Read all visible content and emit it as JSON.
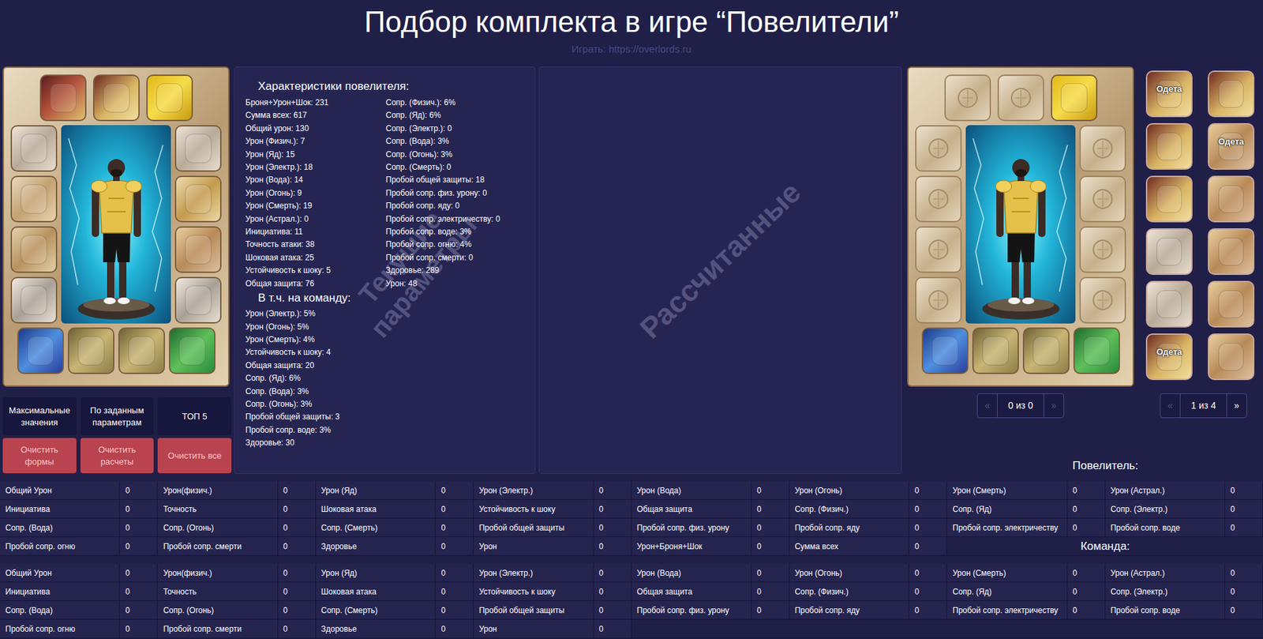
{
  "header": {
    "title": "Подбор комплекта в игре “Повелители”",
    "subtitle": "Играть: https://overlords.ru"
  },
  "current_doll": {
    "top": [
      {
        "kind": "emblem",
        "filled": true
      },
      {
        "kind": "helmet",
        "filled": true
      },
      {
        "kind": "amulet",
        "filled": true
      }
    ],
    "left": [
      {
        "kind": "weapon",
        "filled": true
      },
      {
        "kind": "pants",
        "filled": true
      },
      {
        "kind": "boots",
        "filled": true
      },
      {
        "kind": "ring",
        "filled": true
      }
    ],
    "right": [
      {
        "kind": "weapon",
        "filled": true
      },
      {
        "kind": "armor",
        "filled": true
      },
      {
        "kind": "gloves",
        "filled": true
      },
      {
        "kind": "ring",
        "filled": true
      }
    ],
    "bottom": [
      {
        "kind": "scroll",
        "filled": true
      },
      {
        "kind": "bag",
        "filled": true
      },
      {
        "kind": "bag",
        "filled": true
      },
      {
        "kind": "banner",
        "filled": true
      }
    ]
  },
  "calculated_doll": {
    "top": [
      {
        "kind": "emblem",
        "filled": false
      },
      {
        "kind": "helmet",
        "filled": false
      },
      {
        "kind": "amulet",
        "filled": true
      }
    ],
    "left": [
      {
        "kind": "weapon",
        "filled": false
      },
      {
        "kind": "pants",
        "filled": false
      },
      {
        "kind": "boots",
        "filled": false
      },
      {
        "kind": "ring",
        "filled": false
      }
    ],
    "right": [
      {
        "kind": "weapon",
        "filled": false
      },
      {
        "kind": "armor",
        "filled": false
      },
      {
        "kind": "gloves",
        "filled": false
      },
      {
        "kind": "ring",
        "filled": false
      }
    ],
    "bottom": [
      {
        "kind": "scroll",
        "filled": true
      },
      {
        "kind": "bag",
        "filled": true
      },
      {
        "kind": "bag",
        "filled": true
      },
      {
        "kind": "banner",
        "filled": true
      }
    ]
  },
  "actions": [
    {
      "label": "Максимальные значения",
      "kind": "primary"
    },
    {
      "label": "По заданным параметрам",
      "kind": "primary"
    },
    {
      "label": "ТОП 5",
      "kind": "primary"
    },
    {
      "label": "Очистить формы",
      "kind": "danger"
    },
    {
      "label": "Очистить расчеты",
      "kind": "danger"
    },
    {
      "label": "Очистить все",
      "kind": "danger"
    }
  ],
  "stats": {
    "title": "Характеристики повелителя:",
    "left": [
      "Броня+Урон+Шок: 231",
      "Сумма всех: 617",
      "Общий урон: 130",
      "Урон (Физич.): 7",
      "Урон (Яд): 15",
      "Урон (Электр.): 18",
      "Урон (Вода): 14",
      "Урон (Огонь): 9",
      "Урон (Смерть): 19",
      "Урон (Астрал.): 0",
      "Инициатива: 11",
      "Точность атаки: 38",
      "Шоковая атака: 25",
      "Устойчивость к шоку: 5",
      "Общая защита: 76"
    ],
    "right": [
      "Сопр. (Физич.): 6%",
      "Сопр. (Яд): 6%",
      "Сопр. (Электр.): 0",
      "Сопр. (Вода): 3%",
      "Сопр. (Огонь): 3%",
      "Сопр. (Смерть): 0",
      "Пробой общей защиты: 18",
      "Пробой сопр. физ. урону: 0",
      "Пробой сопр. яду: 0",
      "Пробой сопр. электричеству: 0",
      "Пробой сопр. воде: 3%",
      "Пробой сопр. огню: 4%",
      "Пробой сопр. смерти: 0",
      "Здоровье: 289",
      "Урон: 48"
    ],
    "team_title": "В т.ч. на команду:",
    "team": [
      "Урон (Электр.): 5%",
      "Урон (Огонь): 5%",
      "Урон (Смерть): 4%",
      "Устойчивость к шоку: 4",
      "Общая защита: 20",
      "Сопр. (Яд): 6%",
      "Сопр. (Вода): 3%",
      "Сопр. (Огонь): 3%",
      "Пробой общей защиты: 3",
      "Пробой сопр. воде: 3%",
      "Здоровье: 30"
    ]
  },
  "watermarks": {
    "current": "Текущие параметры",
    "calculated": "Рассчитанные"
  },
  "results_pager": {
    "prev": "«",
    "label": "0 из 0",
    "next": "»",
    "prev_disabled": true,
    "next_disabled": true
  },
  "items": {
    "badge": "Одета",
    "list": [
      {
        "kind": "helmet",
        "equipped": true
      },
      {
        "kind": "helmet",
        "equipped": false
      },
      {
        "kind": "helmet",
        "equipped": false
      },
      {
        "kind": "gloves",
        "equipped": true
      },
      {
        "kind": "helmet",
        "equipped": false
      },
      {
        "kind": "gloves",
        "equipped": false
      },
      {
        "kind": "weapon",
        "equipped": false
      },
      {
        "kind": "gloves",
        "equipped": false
      },
      {
        "kind": "weapon",
        "equipped": false
      },
      {
        "kind": "gloves",
        "equipped": false
      },
      {
        "kind": "helmet",
        "equipped": true
      },
      {
        "kind": "gloves",
        "equipped": false
      }
    ],
    "pager": {
      "prev": "«",
      "label": "1 из 4",
      "next": "»",
      "prev_disabled": true,
      "next_disabled": false
    }
  },
  "lord": {
    "title": "Повелитель:",
    "rows": [
      [
        {
          "label": "Общий Урон",
          "value": "0"
        },
        {
          "label": "Урон(физич.)",
          "value": "0"
        },
        {
          "label": "Урон (Яд)",
          "value": "0"
        },
        {
          "label": "Урон (Электр.)",
          "value": "0"
        },
        {
          "label": "Урон (Вода)",
          "value": "0"
        },
        {
          "label": "Урон (Огонь)",
          "value": "0"
        },
        {
          "label": "Урон (Смерть)",
          "value": "0"
        },
        {
          "label": "Урон (Астрал.)",
          "value": "0"
        }
      ],
      [
        {
          "label": "Инициатива",
          "value": "0"
        },
        {
          "label": "Точность",
          "value": "0"
        },
        {
          "label": "Шоковая атака",
          "value": "0"
        },
        {
          "label": "Устойчивость к шоку",
          "value": "0"
        },
        {
          "label": "Общая защита",
          "value": "0"
        },
        {
          "label": "Сопр. (Физич.)",
          "value": "0"
        },
        {
          "label": "Сопр. (Яд)",
          "value": "0"
        },
        {
          "label": "Сопр. (Электр.)",
          "value": "0"
        }
      ],
      [
        {
          "label": "Сопр. (Вода)",
          "value": "0"
        },
        {
          "label": "Сопр. (Огонь)",
          "value": "0"
        },
        {
          "label": "Сопр. (Смерть)",
          "value": "0"
        },
        {
          "label": "Пробой общей защиты",
          "value": "0"
        },
        {
          "label": "Пробой сопр. физ. урону",
          "value": "0"
        },
        {
          "label": "Пробой сопр. яду",
          "value": "0"
        },
        {
          "label": "Пробой сопр. электричеству",
          "value": "0"
        },
        {
          "label": "Пробой сопр. воде",
          "value": "0"
        }
      ],
      [
        {
          "label": "Пробой сопр. огню",
          "value": "0"
        },
        {
          "label": "Пробой сопр. смерти",
          "value": "0"
        },
        {
          "label": "Здоровье",
          "value": "0"
        },
        {
          "label": "Урон",
          "value": "0"
        },
        {
          "label": "Урон+Броня+Шок",
          "value": "0"
        },
        {
          "label": "Сумма всех",
          "value": "0"
        }
      ]
    ]
  },
  "team": {
    "title": "Команда:",
    "rows": [
      [
        {
          "label": "Общий Урон",
          "value": "0"
        },
        {
          "label": "Урон(физич.)",
          "value": "0"
        },
        {
          "label": "Урон (Яд)",
          "value": "0"
        },
        {
          "label": "Урон (Электр.)",
          "value": "0"
        },
        {
          "label": "Урон (Вода)",
          "value": "0"
        },
        {
          "label": "Урон (Огонь)",
          "value": "0"
        },
        {
          "label": "Урон (Смерть)",
          "value": "0"
        },
        {
          "label": "Урон (Астрал.)",
          "value": "0"
        }
      ],
      [
        {
          "label": "Инициатива",
          "value": "0"
        },
        {
          "label": "Точность",
          "value": "0"
        },
        {
          "label": "Шоковая атака",
          "value": "0"
        },
        {
          "label": "Устойчивость к шоку",
          "value": "0"
        },
        {
          "label": "Общая защита",
          "value": "0"
        },
        {
          "label": "Сопр. (Физич.)",
          "value": "0"
        },
        {
          "label": "Сопр. (Яд)",
          "value": "0"
        },
        {
          "label": "Сопр. (Электр.)",
          "value": "0"
        }
      ],
      [
        {
          "label": "Сопр. (Вода)",
          "value": "0"
        },
        {
          "label": "Сопр. (Огонь)",
          "value": "0"
        },
        {
          "label": "Сопр. (Смерть)",
          "value": "0"
        },
        {
          "label": "Пробой общей защиты",
          "value": "0"
        },
        {
          "label": "Пробой сопр. физ. урону",
          "value": "0"
        },
        {
          "label": "Пробой сопр. яду",
          "value": "0"
        },
        {
          "label": "Пробой сопр. электричеству",
          "value": "0"
        },
        {
          "label": "Пробой сопр. воде",
          "value": "0"
        }
      ],
      [
        {
          "label": "Пробой сопр. огню",
          "value": "0"
        },
        {
          "label": "Пробой сопр. смерти",
          "value": "0"
        },
        {
          "label": "Здоровье",
          "value": "0"
        },
        {
          "label": "Урон",
          "value": "0"
        }
      ]
    ]
  }
}
